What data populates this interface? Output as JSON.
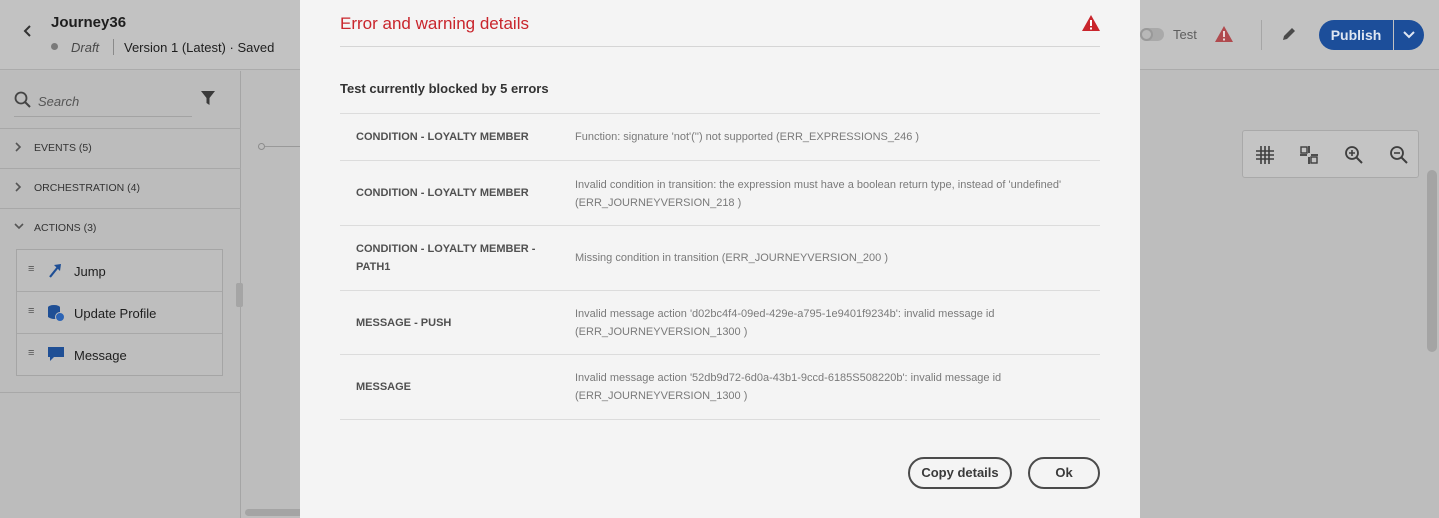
{
  "header": {
    "back_icon": "chevron-left-icon",
    "title": "Journey36",
    "status": "Draft",
    "version": "Version 1 (Latest) · Saved",
    "test_label": "Test",
    "publish_label": "Publish",
    "colors": {
      "publish": "#1c4e9a",
      "warning": "#c9252c"
    }
  },
  "left_panel": {
    "search_placeholder": "Search",
    "sections": [
      {
        "label": "EVENTS (5)",
        "expanded": false
      },
      {
        "label": "ORCHESTRATION (4)",
        "expanded": false
      },
      {
        "label": "ACTIONS (3)",
        "expanded": true
      }
    ],
    "actions": [
      {
        "label": "Jump",
        "icon": "jump-arrow-icon"
      },
      {
        "label": "Update Profile",
        "icon": "database-icon"
      },
      {
        "label": "Message",
        "icon": "chat-bubble-icon"
      }
    ]
  },
  "modal": {
    "title": "Error and warning details",
    "summary": "Test currently blocked by 5 errors",
    "errors": [
      {
        "source": "CONDITION - LOYALTY MEMBER",
        "message": "Function: signature 'not'('') not supported (ERR_EXPRESSIONS_246 )"
      },
      {
        "source": "CONDITION - LOYALTY MEMBER",
        "message": "Invalid condition in transition: the expression must have a boolean return type, instead of 'undefined' (ERR_JOURNEYVERSION_218 )"
      },
      {
        "source": "CONDITION - LOYALTY MEMBER - PATH1",
        "message": "Missing condition in transition (ERR_JOURNEYVERSION_200 )"
      },
      {
        "source": "MESSAGE - PUSH",
        "message": "Invalid message action 'd02bc4f4-09ed-429e-a795-1e9401f9234b': invalid message id (ERR_JOURNEYVERSION_1300 )"
      },
      {
        "source": "MESSAGE",
        "message": "Invalid message action '52db9d72-6d0a-43b1-9ccd-6185S508220b': invalid message id (ERR_JOURNEYVERSION_1300 )"
      }
    ],
    "copy_label": "Copy details",
    "ok_label": "Ok"
  }
}
